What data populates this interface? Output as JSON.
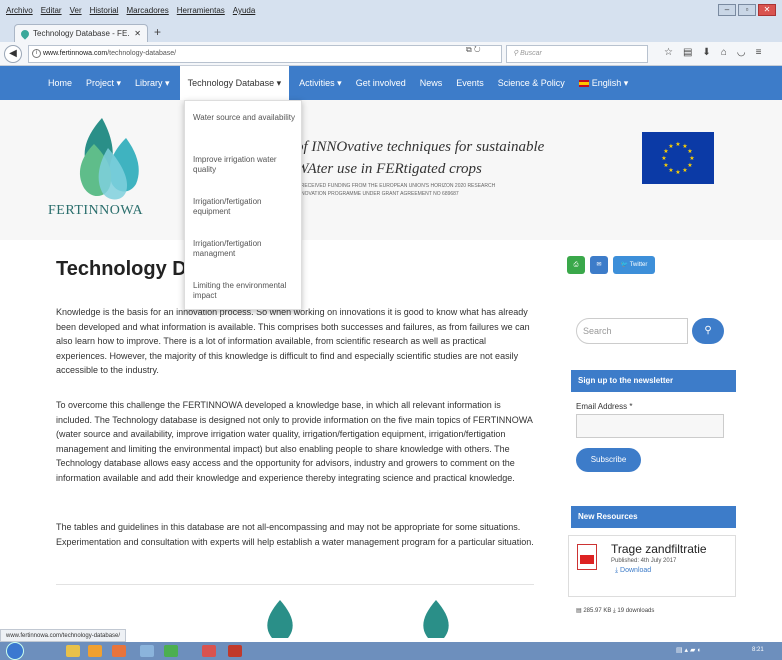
{
  "browser": {
    "menus": [
      "Archivo",
      "Editar",
      "Ver",
      "Historial",
      "Marcadores",
      "Herramientas",
      "Ayuda"
    ],
    "tab_title": "Technology Database - FE...",
    "url_domain": "www.fertinnowa.com",
    "url_path": "/technology-database/",
    "search_placeholder": "Buscar",
    "status_url": "www.fertinnowa.com/technology-database/"
  },
  "nav": {
    "items": [
      "Home",
      "Project ▾",
      "Library ▾",
      "Technology Database ▾",
      "Activities ▾",
      "Get involved",
      "News",
      "Events",
      "Science & Policy",
      "English ▾"
    ]
  },
  "dropdown": {
    "items": [
      "Water source and availability",
      "Improve irrigation water quality",
      "Irrigation/fertigation equipment",
      "Irrigation/fertigation managment",
      "Limiting the environmental impact"
    ]
  },
  "header": {
    "logo_text": "FERTINNOWA",
    "tagline_1": "of INNOvative techniques for sustainable",
    "tagline_2": "WAter use in FERtigated crops",
    "funding_1": "S RECEIVED FUNDING FROM THE EUROPEAN UNION'S HORIZON 2020 RESEARCH",
    "funding_2": "INNOVATION PROGRAMME UNDER GRANT AGREEMENT NO 689687"
  },
  "main": {
    "title": "Technology Da",
    "para1": "Knowledge is the basis for an innovation process. So when working on innovations it is good to know what has already been developed and what information is available. This comprises both successes and failures, as from failures we can also learn how to improve. There is a lot of information available, from scientific research as well as practical experiences. However, the majority of this knowledge is difficult to find and especially scientific studies are not easily accessible to the industry.",
    "para2": "To overcome this challenge the FERTINNOWA developed a knowledge base, in which all relevant information is included. The Technology database is designed not only to provide information on the five main topics of FERTINNOWA (water source and availability, improve irrigation water quality, irrigation/fertigation equipment, irrigation/fertigation management and limiting the environmental impact) but also enabling people to share knowledge with others. The Technology database allows easy access and the opportunity for advisors, industry and growers to comment on the information available and add their knowledge and experience thereby integrating science and practical knowledge.",
    "para3": "The tables and guidelines in this database are not all-encompassing and may not be appropriate for some situations. Experimentation and consultation with experts will help establish a water management program for a particular situation."
  },
  "sidebar": {
    "twitter_label": "Twitter",
    "search_placeholder": "Search",
    "newsletter_title": "Sign up to the newsletter",
    "email_label": "Email Address *",
    "subscribe_label": "Subscribe",
    "resources_title": "New Resources",
    "resource": {
      "title": "Trage zandfiltratie",
      "published": "Published: 4th July 2017",
      "download_label": "Download",
      "meta": "285.97 KB  ⤓ 19 downloads"
    }
  },
  "colors": {
    "brand_blue": "#3d7cc9",
    "teal": "#2a8f88"
  }
}
